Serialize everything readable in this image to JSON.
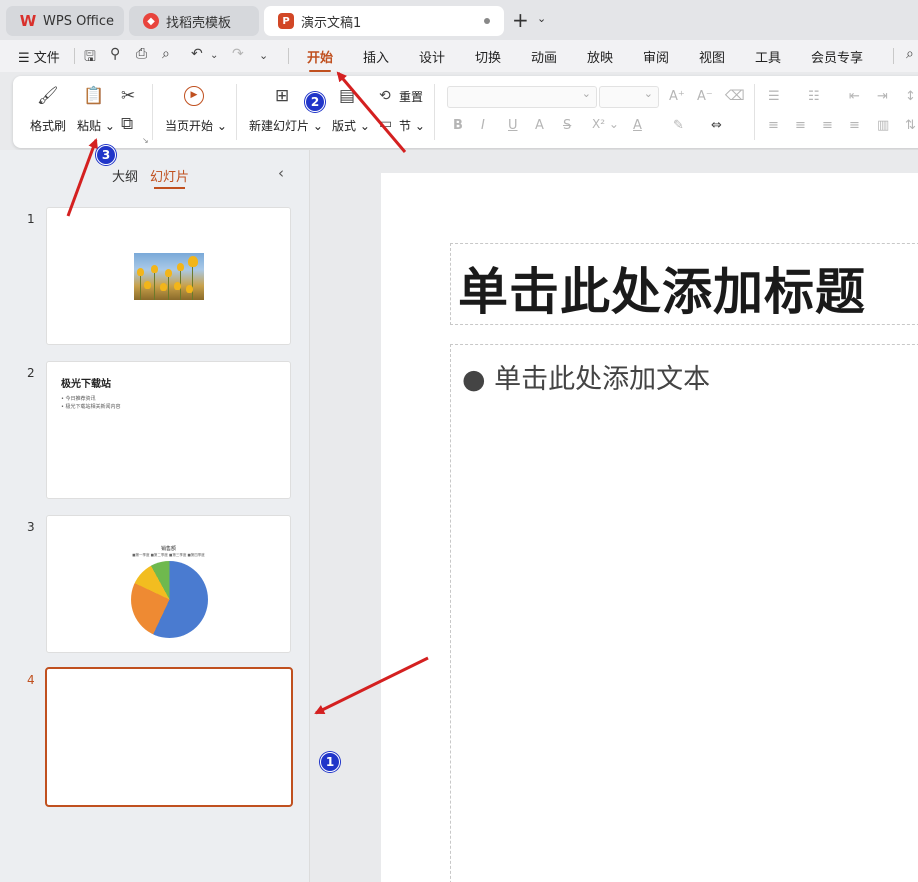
{
  "tabs": [
    {
      "label": "WPS Office",
      "icon": "wps-logo-icon"
    },
    {
      "label": "找稻壳模板",
      "icon": "docer-icon"
    },
    {
      "label": "演示文稿1",
      "icon": "presentation-icon",
      "active": true
    }
  ],
  "menubar": {
    "file_label": "文件",
    "items": [
      "开始",
      "插入",
      "设计",
      "切换",
      "动画",
      "放映",
      "审阅",
      "视图",
      "工具",
      "会员专享"
    ],
    "active": "开始"
  },
  "ribbon": {
    "format_painter": "格式刷",
    "paste": "粘贴",
    "play_from_current": "当页开始",
    "new_slide": "新建幻灯片",
    "layout": "版式",
    "reset": "重置",
    "section": "节",
    "superscript": "X²"
  },
  "panel": {
    "tab_outline": "大纲",
    "tab_slides": "幻灯片",
    "slides": [
      {
        "num": "1"
      },
      {
        "num": "2",
        "title": "极光下载站",
        "bullets": [
          "今日推荐资讯",
          "极光下载站相关新闻内容"
        ]
      },
      {
        "num": "3",
        "chart_title": "销售额",
        "legend": "■第一季度 ■第二季度 ■第三季度 ■第四季度"
      },
      {
        "num": "4"
      }
    ]
  },
  "slide": {
    "title_placeholder": "单击此处添加标题",
    "body_placeholder": "● 单击此处添加文本"
  },
  "annotations": [
    "1",
    "2",
    "3"
  ],
  "colors": {
    "accent": "#c0501f",
    "badge": "#2035c9",
    "arrow": "#d42020"
  }
}
